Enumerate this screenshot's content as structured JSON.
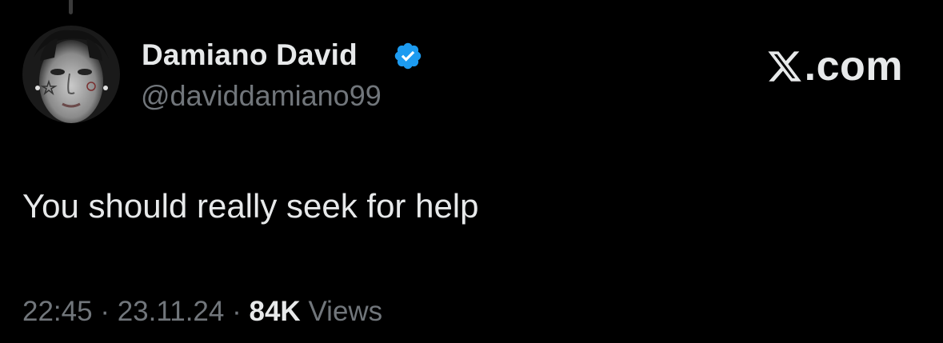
{
  "tweet": {
    "author": {
      "display_name": "Damiano David",
      "handle": "@daviddamiano99",
      "verified": true,
      "verified_color": "#1d9bf0",
      "avatar": "profile-photo"
    },
    "text": "You should really seek for help",
    "meta": {
      "time": "22:45",
      "separator": "·",
      "date": "23.11.24",
      "views_count": "84K",
      "views_label": "Views"
    }
  },
  "brand": {
    "icon": "x-logo-icon",
    "text": ".com"
  },
  "colors": {
    "background": "#000000",
    "primary_text": "#e7e9ea",
    "secondary_text": "#71767b"
  }
}
